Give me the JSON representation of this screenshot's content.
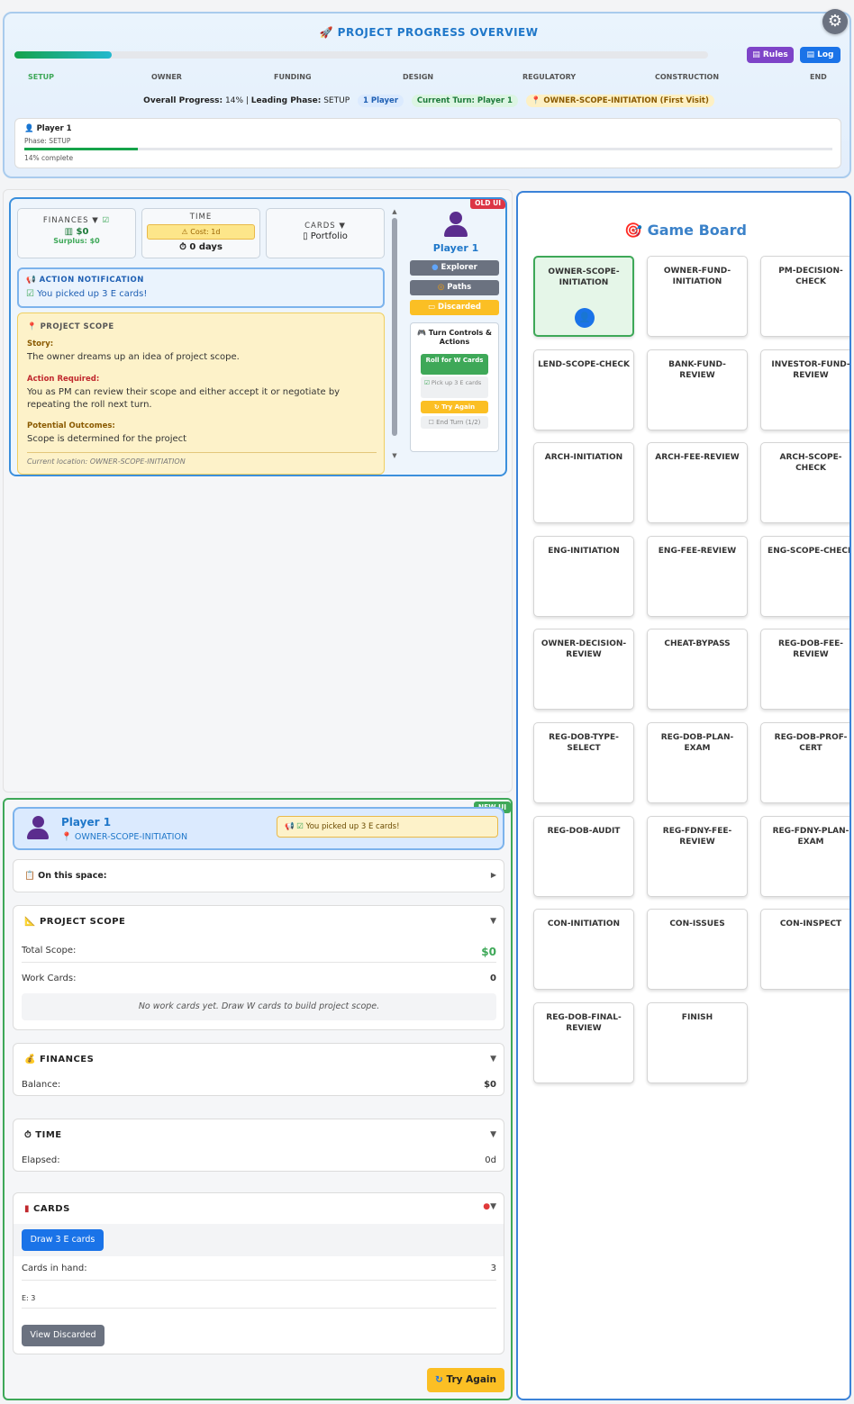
{
  "header": {
    "title": "PROJECT PROGRESS OVERVIEW",
    "rules_label": "Rules",
    "log_label": "Log",
    "progress": 0.14,
    "phases": [
      "SETUP",
      "OWNER",
      "FUNDING",
      "DESIGN",
      "REGULATORY",
      "CONSTRUCTION",
      "END"
    ],
    "overall_label": "Overall Progress:",
    "overall_value": "14%",
    "leading_label": "Leading Phase:",
    "leading_value": "SETUP",
    "players_pill": "1 Player",
    "turn_pill": "Current Turn: Player 1",
    "location_pill": "OWNER-SCOPE-INITIATION (First Visit)",
    "player_card": {
      "name": "Player 1",
      "phase": "Phase: SETUP",
      "progress": 0.14,
      "complete": "14% complete"
    }
  },
  "old_ui": {
    "badge": "OLD UI",
    "finances": {
      "label": "FINANCES ▼",
      "value": "$0",
      "surplus": "Surplus: $0"
    },
    "time": {
      "label": "TIME",
      "cost": "Cost: 1d",
      "days": "0 days"
    },
    "cards": {
      "label": "CARDS ▼",
      "value": "Portfolio"
    },
    "notification": {
      "title": "ACTION NOTIFICATION",
      "text": "You picked up 3 E cards!"
    },
    "scope": {
      "title": "PROJECT SCOPE",
      "story_label": "Story:",
      "story": "The owner dreams up an idea of project scope.",
      "action_label": "Action Required:",
      "action": "You as PM can review their scope and either accept it or negotiate by repeating the roll next turn.",
      "outcomes_label": "Potential Outcomes:",
      "outcomes": "Scope is determined for the project",
      "location": "Current location: OWNER-SCOPE-INITIATION"
    },
    "side": {
      "player": "Player 1",
      "explorer": "Explorer",
      "paths": "Paths",
      "discarded": "Discarded",
      "turn_controls": "Turn Controls & Actions",
      "roll_w": "Roll for W Cards",
      "pick_up": "Pick up 3 E cards",
      "try_again": "Try Again",
      "end_turn": "End Turn (1/2)"
    }
  },
  "new_ui": {
    "badge": "NEW UI",
    "player": "Player 1",
    "location": "OWNER-SCOPE-INITIATION",
    "notification": "You picked up 3 E cards!",
    "on_space": "On this space:",
    "scope": {
      "title": "PROJECT SCOPE",
      "total_label": "Total Scope:",
      "total_value": "$0",
      "work_label": "Work Cards:",
      "work_value": "0",
      "empty": "No work cards yet. Draw W cards to build project scope."
    },
    "finances": {
      "title": "FINANCES",
      "balance_label": "Balance:",
      "balance_value": "$0"
    },
    "time": {
      "title": "TIME",
      "elapsed_label": "Elapsed:",
      "elapsed_value": "0d"
    },
    "cards": {
      "title": "CARDS",
      "draw_label": "Draw 3 E cards",
      "hand_label": "Cards in hand:",
      "hand_value": "3",
      "breakdown": "E: 3",
      "view_discarded": "View Discarded"
    },
    "try_again": "Try Again"
  },
  "board": {
    "title": "Game Board",
    "tiles": [
      "OWNER-SCOPE-INITIATION",
      "OWNER-FUND-INITIATION",
      "PM-DECISION-CHECK",
      "LEND-SCOPE-CHECK",
      "BANK-FUND-REVIEW",
      "INVESTOR-FUND-REVIEW",
      "ARCH-INITIATION",
      "ARCH-FEE-REVIEW",
      "ARCH-SCOPE-CHECK",
      "ENG-INITIATION",
      "ENG-FEE-REVIEW",
      "ENG-SCOPE-CHECK",
      "OWNER-DECISION-REVIEW",
      "CHEAT-BYPASS",
      "REG-DOB-FEE-REVIEW",
      "REG-DOB-TYPE-SELECT",
      "REG-DOB-PLAN-EXAM",
      "REG-DOB-PROF-CERT",
      "REG-DOB-AUDIT",
      "REG-FDNY-FEE-REVIEW",
      "REG-FDNY-PLAN-EXAM",
      "CON-INITIATION",
      "CON-ISSUES",
      "CON-INSPECT",
      "REG-DOB-FINAL-REVIEW",
      "FINISH"
    ]
  }
}
